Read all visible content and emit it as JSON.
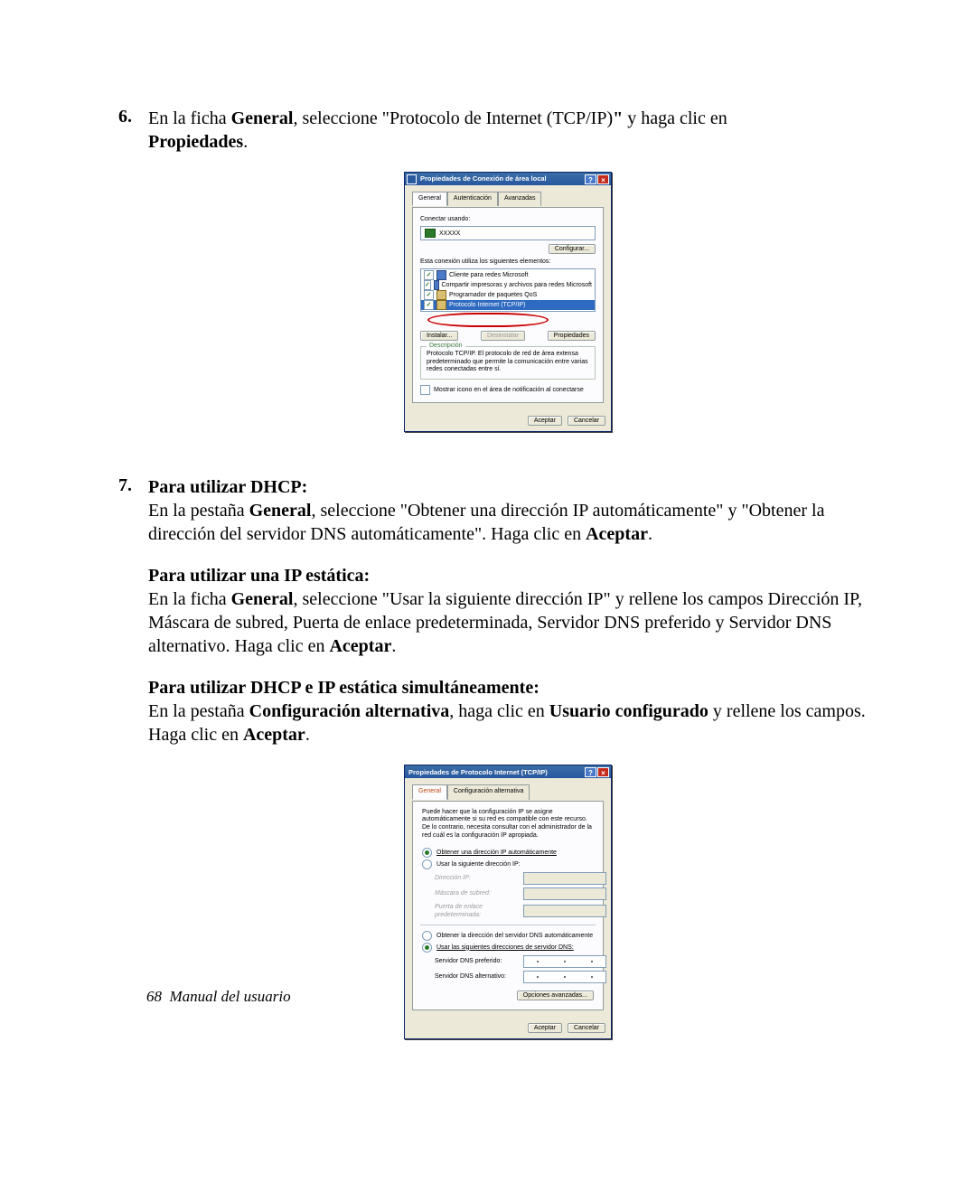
{
  "step6": {
    "num": "6.",
    "text_a": "En la ficha ",
    "general": "General",
    "text_b": ", seleccione \"Protocolo de Internet (TCP/IP)",
    "quote_bold": "\"",
    "text_c": " y haga clic en ",
    "propiedades": "Propiedades",
    "text_d": "."
  },
  "dialog1": {
    "title": "Propiedades de Conexión de área local",
    "tab1": "General",
    "tab2": "Autenticación",
    "tab3": "Avanzadas",
    "connect_using": "Conectar usando:",
    "adapter": "XXXXX",
    "configure": "Configurar...",
    "list_label": "Esta conexión utiliza los siguientes elementos:",
    "item1": "Cliente para redes Microsoft",
    "item2": "Compartir impresoras y archivos para redes Microsoft",
    "item3": "Programador de paquetes QoS",
    "item4": "Protocolo Internet (TCP/IP)",
    "btn_install": "Instalar...",
    "btn_uninstall": "Desinstalar",
    "btn_props": "Propiedades",
    "desc_legend": "Descripción",
    "desc_text": "Protocolo TCP/IP. El protocolo de red de área extensa predeterminado que permite la comunicación entre varias redes conectadas entre sí.",
    "show_icon": "Mostrar icono en el área de notificación al conectarse",
    "accept": "Aceptar",
    "cancel": "Cancelar"
  },
  "step7": {
    "num": "7.",
    "h_dhcp": "Para utilizar DHCP:",
    "p1a": "En la pestaña ",
    "p1b": "General",
    "p1c": ", seleccione \"Obtener una dirección IP automáticamente\" y \"Obtener la dirección del servidor DNS automáticamente\". Haga clic en ",
    "p1d": "Aceptar",
    "p1e": ".",
    "h_static": "Para utilizar una IP estática:",
    "p2a": "En la ficha ",
    "p2b": "General",
    "p2c": ", seleccione \"Usar la siguiente dirección IP\" y rellene los campos Dirección IP, Máscara de subred, Puerta de enlace predeterminada, Servidor DNS preferido y Servidor DNS alternativo. Haga clic en ",
    "p2d": "Aceptar",
    "p2e": ".",
    "h_both": "Para utilizar DHCP e IP estática simultáneamente:",
    "p3a": "En la pestaña ",
    "p3b": "Configuración alternativa",
    "p3c": ", haga clic en ",
    "p3d": "Usuario configurado",
    "p3e": " y rellene los campos. Haga clic en ",
    "p3f": "Aceptar",
    "p3g": "."
  },
  "dialog2": {
    "title": "Propiedades de Protocolo Internet (TCP/IP)",
    "tab1": "General",
    "tab2": "Configuración alternativa",
    "intro": "Puede hacer que la configuración IP se asigne automáticamente si su red es compatible con este recurso. De lo contrario, necesita consultar con el administrador de la red cuál es la configuración IP apropiada.",
    "r1": "Obtener una dirección IP automáticamente",
    "r2": "Usar la siguiente dirección IP:",
    "f_ip": "Dirección IP:",
    "f_mask": "Máscara de subred:",
    "f_gw": "Puerta de enlace predeterminada:",
    "r3": "Obtener la dirección del servidor DNS automáticamente",
    "r4": "Usar las siguientes direcciones de servidor DNS:",
    "f_dns1": "Servidor DNS preferido:",
    "f_dns2": "Servidor DNS alternativo:",
    "btn_adv": "Opciones avanzadas...",
    "accept": "Aceptar",
    "cancel": "Cancelar"
  },
  "footer": {
    "page": "68",
    "text": "Manual del usuario"
  }
}
